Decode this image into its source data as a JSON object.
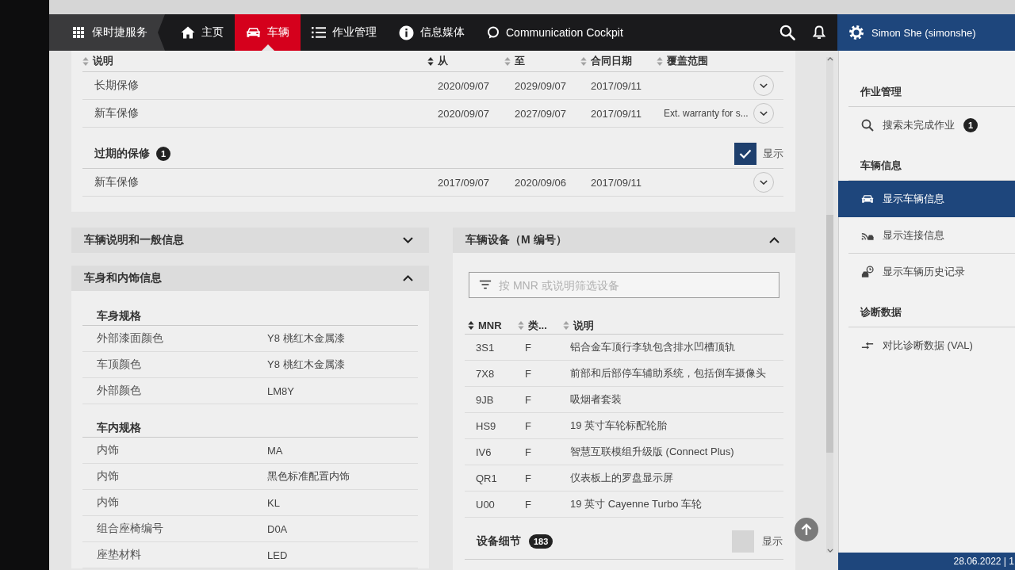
{
  "nav": {
    "app_menu": "保时捷服务",
    "tabs": [
      {
        "label": "主页",
        "selected": false
      },
      {
        "label": "车辆",
        "selected": true
      },
      {
        "label": "作业管理",
        "selected": false
      },
      {
        "label": "信息媒体",
        "selected": false
      },
      {
        "label": "Communication Cockpit",
        "selected": false
      }
    ],
    "user": "Simon She (simonshe)"
  },
  "warranty": {
    "columns": [
      {
        "label": "说明",
        "sorted": false
      },
      {
        "label": "从",
        "sorted": true
      },
      {
        "label": "至",
        "sorted": false
      },
      {
        "label": "合同日期",
        "sorted": false
      },
      {
        "label": "覆盖范围",
        "sorted": false
      }
    ],
    "rows": [
      {
        "description": "长期保修",
        "from": "2020/09/07",
        "to": "2029/09/07",
        "contract_date": "2017/09/11"
      },
      {
        "description": "新车保修",
        "from": "2020/09/07",
        "to": "2027/09/07",
        "contract_date": "2017/09/11",
        "coverage": "Ext. warranty for s..."
      }
    ],
    "expired": {
      "title": "过期的保修",
      "count": "1",
      "show": {
        "label": "显示",
        "checked": true
      },
      "rows": [
        {
          "description": "新车保修",
          "from": "2017/09/07",
          "to": "2020/09/06",
          "contract_date": "2017/09/11"
        }
      ]
    }
  },
  "vehicle_panels": [
    {
      "title": "车辆说明和一般信息",
      "expanded": false
    },
    {
      "title": "车身和内饰信息",
      "expanded": true,
      "groups": [
        {
          "title": "车身规格",
          "rows": [
            {
              "label": "外部漆面颜色",
              "value": "Y8 桃红木金属漆"
            },
            {
              "label": "车顶颜色",
              "value": "Y8 桃红木金属漆"
            },
            {
              "label": "外部颜色",
              "value": "LM8Y"
            }
          ]
        },
        {
          "title": "车内规格",
          "rows": [
            {
              "label": "内饰",
              "value": "MA"
            },
            {
              "label": "内饰",
              "value": "黑色标准配置内饰"
            },
            {
              "label": "内饰",
              "value": "KL"
            },
            {
              "label": "组合座椅编号",
              "value": "D0A"
            },
            {
              "label": "座垫材料",
              "value": "LED"
            }
          ]
        }
      ]
    }
  ],
  "equipment": {
    "title": "车辆设备（M 编号）",
    "expanded": true,
    "filter": {
      "placeholder": "按 MNR 或说明筛选设备"
    },
    "columns": [
      {
        "label": "MNR",
        "sorted": true
      },
      {
        "label": "类...",
        "sorted": false
      },
      {
        "label": "说明",
        "sorted": false
      }
    ],
    "rows": [
      {
        "mnr": "3S1",
        "type": "F",
        "description": "铝合金车顶行李轨包含排水凹槽顶轨"
      },
      {
        "mnr": "7X8",
        "type": "F",
        "description": "前部和后部停车辅助系统，包括倒车摄像头"
      },
      {
        "mnr": "9JB",
        "type": "F",
        "description": "吸烟者套装"
      },
      {
        "mnr": "HS9",
        "type": "F",
        "description": "19 英寸车轮标配轮胎"
      },
      {
        "mnr": "IV6",
        "type": "F",
        "description": "智慧互联模组升级版 (Connect Plus)"
      },
      {
        "mnr": "QR1",
        "type": "F",
        "description": "仪表板上的罗盘显示屏"
      },
      {
        "mnr": "U00",
        "type": "F",
        "description": "19 英寸 Cayenne Turbo 车轮"
      }
    ],
    "details": {
      "title": "设备细节",
      "count": "183",
      "show": {
        "label": "显示",
        "checked": false
      }
    }
  },
  "sidebar": {
    "sections": [
      {
        "title": "作业管理",
        "items": [
          {
            "label": "搜索未完成作业",
            "badge": "1",
            "selected": false
          }
        ]
      },
      {
        "title": "车辆信息",
        "items": [
          {
            "label": "显示车辆信息",
            "selected": true
          },
          {
            "label": "显示连接信息",
            "selected": false
          },
          {
            "label": "显示车辆历史记录",
            "selected": false
          }
        ]
      },
      {
        "title": "诊断数据",
        "items": [
          {
            "label": "对比诊断数据 (VAL)",
            "selected": false
          }
        ]
      }
    ]
  },
  "status_bar": {
    "text": "28.06.2022 | 1"
  }
}
